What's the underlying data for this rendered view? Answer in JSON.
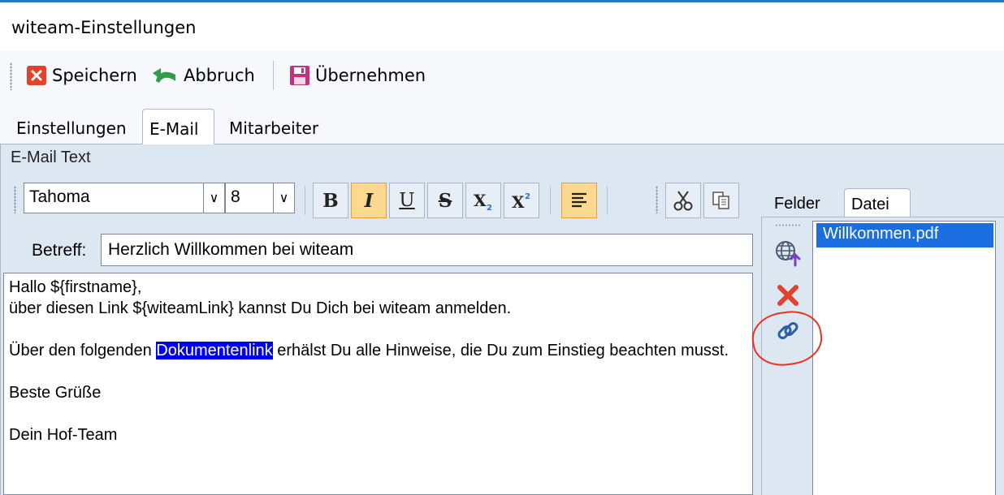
{
  "window": {
    "title": "witeam-Einstellungen"
  },
  "toolbar": {
    "save_label": "Speichern",
    "cancel_label": "Abbruch",
    "apply_label": "Übernehmen"
  },
  "tabs": [
    {
      "label": "Einstellungen",
      "active": false
    },
    {
      "label": "E-Mail",
      "active": true
    },
    {
      "label": "Mitarbeiter",
      "active": false
    }
  ],
  "section": {
    "title": "E-Mail Text"
  },
  "format": {
    "font_family": "Tahoma",
    "font_size": "8",
    "bold_label": "B",
    "italic_label": "I",
    "underline_label": "U",
    "strike_label": "S"
  },
  "subject": {
    "label": "Betreff:",
    "value": "Herzlich Willkommen bei witeam"
  },
  "body": {
    "line1": "Hallo ${firstname},",
    "line2": "über diesen Link ${witeamLink} kannst Du Dich bei witeam anmelden.",
    "line4_before": "Über den folgenden ",
    "line4_selected": "Dokumentenlink",
    "line4_after": " erhälst Du alle Hinweise, die Du zum Einstieg beachten musst.",
    "line6": "Beste Grüße",
    "line8": "Dein Hof-Team"
  },
  "side": {
    "tabs": [
      {
        "label": "Felder",
        "active": false
      },
      {
        "label": "Datei",
        "active": true
      }
    ],
    "files": [
      "Willkommen.pdf"
    ]
  },
  "colors": {
    "accent": "#2b78b8",
    "selection": "#0000ee",
    "list_selection": "#1a6ee0",
    "annotation": "#e8321f"
  }
}
